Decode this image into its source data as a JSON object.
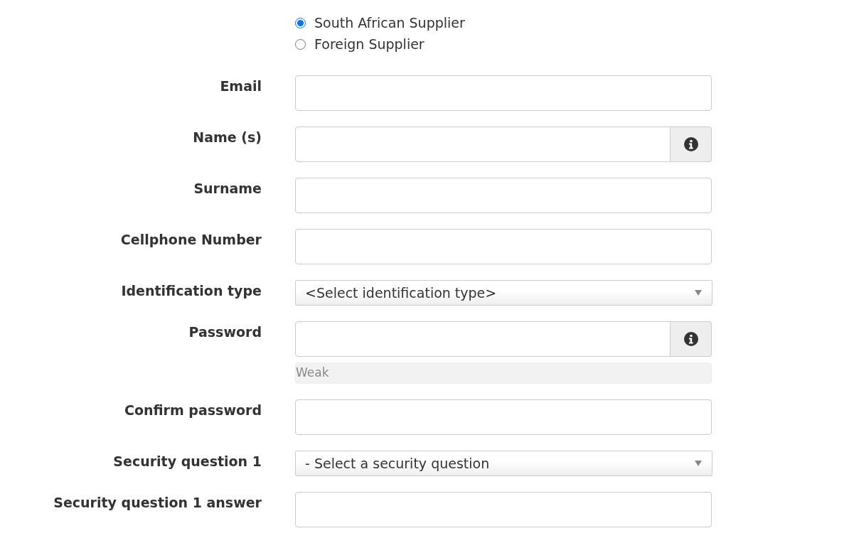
{
  "supplier_type": [
    {
      "label": "South African Supplier",
      "selected": true
    },
    {
      "label": "Foreign Supplier",
      "selected": false
    }
  ],
  "fields": [
    {
      "kind": "text",
      "label": "Email"
    },
    {
      "kind": "info",
      "label": "Name (s)"
    },
    {
      "kind": "text",
      "label": "Surname"
    },
    {
      "kind": "text",
      "label": "Cellphone Number"
    },
    {
      "kind": "select",
      "label": "Identification type",
      "value": "<Select identification type>"
    },
    {
      "kind": "password",
      "label": "Password",
      "strength": {
        "label": "Weak"
      }
    },
    {
      "kind": "text",
      "label": "Confirm password"
    },
    {
      "kind": "select",
      "label": "Security question 1",
      "value": "- Select a security question"
    },
    {
      "kind": "text",
      "label": "Security question 1 answer"
    }
  ]
}
